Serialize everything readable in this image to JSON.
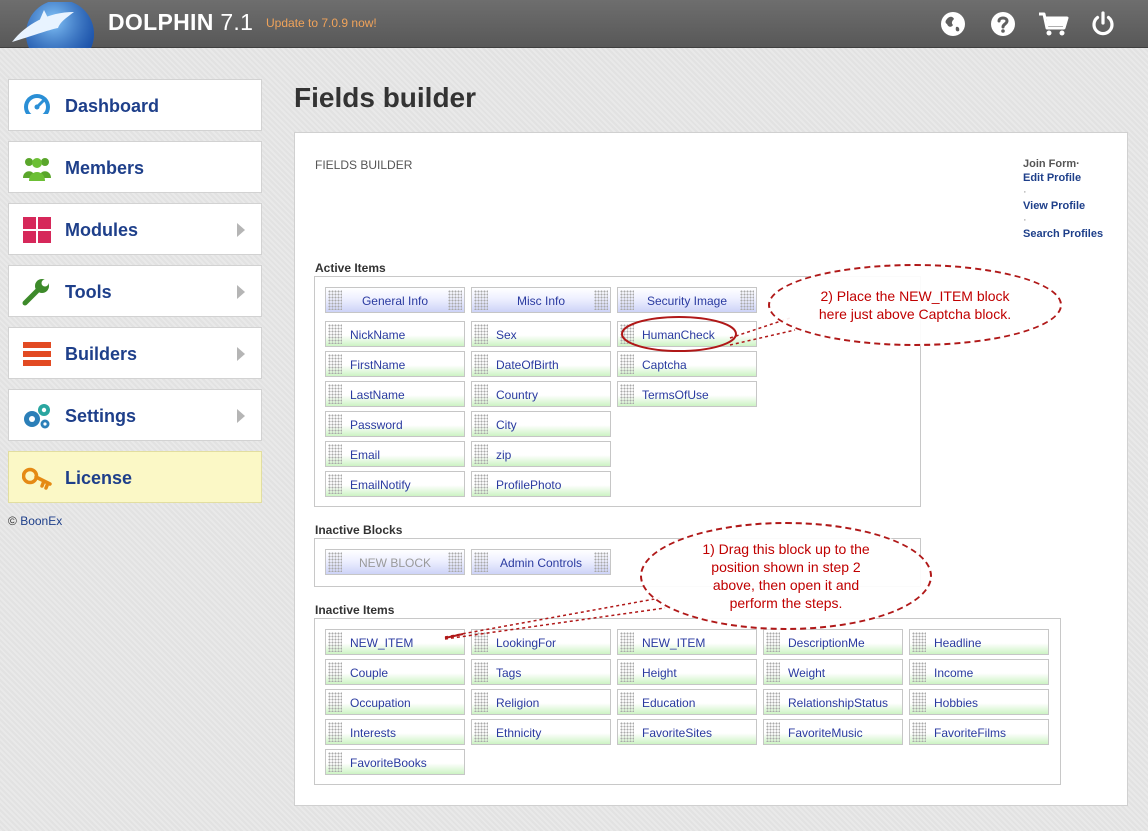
{
  "header": {
    "brand": "DOLPHIN",
    "version": "7.1",
    "update_notice": "Update to 7.0.9 now!",
    "icons": [
      "globe-icon",
      "help-icon",
      "cart-icon",
      "power-icon"
    ]
  },
  "sidebar": {
    "items": [
      {
        "label": "Dashboard",
        "icon": "dashboard-icon",
        "has_submenu": false
      },
      {
        "label": "Members",
        "icon": "members-icon",
        "has_submenu": false
      },
      {
        "label": "Modules",
        "icon": "modules-icon",
        "has_submenu": true
      },
      {
        "label": "Tools",
        "icon": "wrench-icon",
        "has_submenu": true
      },
      {
        "label": "Builders",
        "icon": "builders-icon",
        "has_submenu": true
      },
      {
        "label": "Settings",
        "icon": "gears-icon",
        "has_submenu": true
      },
      {
        "label": "License",
        "icon": "key-icon",
        "has_submenu": false
      }
    ],
    "copyright_symbol": "©",
    "copyright_link": "BoonEx"
  },
  "main": {
    "title": "Fields builder",
    "panel_caption": "FIELDS BUILDER",
    "forms": {
      "current": "Join Form",
      "links": [
        "Edit Profile",
        "View Profile",
        "Search Profiles"
      ]
    },
    "active_items": {
      "label": "Active Items",
      "blocks": [
        "General Info",
        "Misc Info",
        "Security Image"
      ],
      "columns": [
        [
          "NickName",
          "FirstName",
          "LastName",
          "Password",
          "Email",
          "EmailNotify"
        ],
        [
          "Sex",
          "DateOfBirth",
          "Country",
          "City",
          "zip",
          "ProfilePhoto"
        ],
        [
          "HumanCheck",
          "Captcha",
          "TermsOfUse"
        ]
      ]
    },
    "inactive_blocks": {
      "label": "Inactive Blocks",
      "blocks": [
        "NEW BLOCK",
        "Admin Controls"
      ]
    },
    "inactive_items": {
      "label": "Inactive Items",
      "items": [
        "NEW_ITEM",
        "LookingFor",
        "NEW_ITEM",
        "DescriptionMe",
        "Headline",
        "Couple",
        "Tags",
        "Height",
        "Weight",
        "Income",
        "Occupation",
        "Religion",
        "Education",
        "RelationshipStatus",
        "Hobbies",
        "Interests",
        "Ethnicity",
        "FavoriteSites",
        "FavoriteMusic",
        "FavoriteFilms",
        "FavoriteBooks"
      ]
    }
  },
  "annotations": {
    "step2": "2) Place the NEW_ITEM block here just above Captcha block.",
    "step1": "1) Drag this block up to the position shown in step 2 above, then open it and perform the steps."
  },
  "colors": {
    "brand_blue": "#1e3f8a",
    "item_text": "#2a3aa0",
    "annotation_red": "#c00000",
    "update_orange": "#f0a35a"
  }
}
